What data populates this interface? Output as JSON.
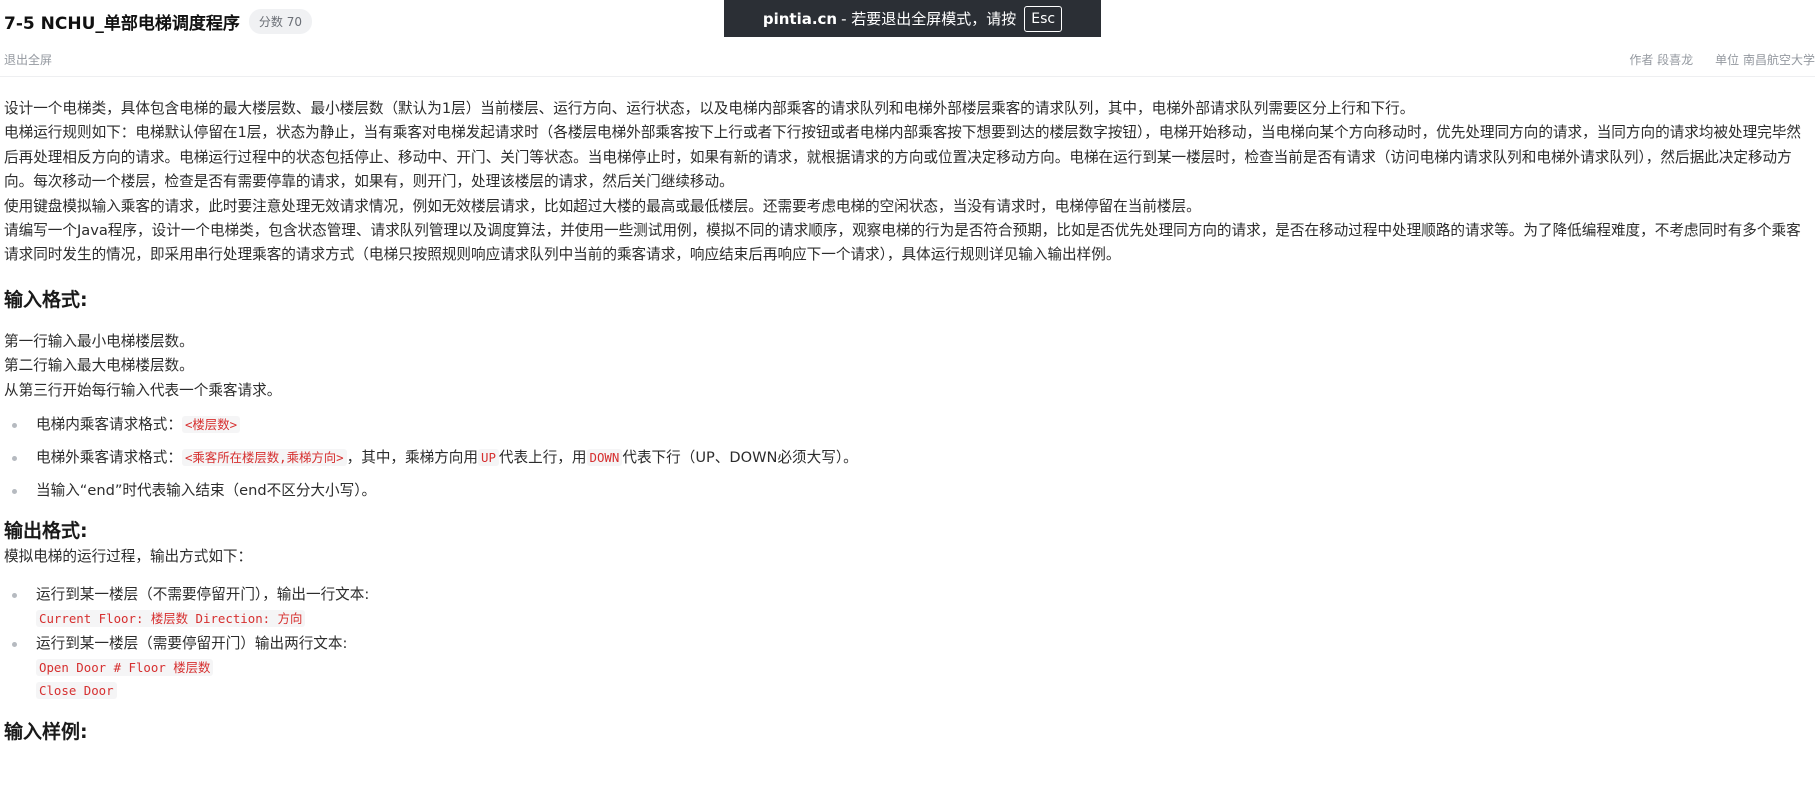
{
  "header": {
    "title": "7-5 NCHU_单部电梯调度程序",
    "score_badge": "分数 70"
  },
  "fullscreen_banner": {
    "domain": "pintia.cn",
    "text": "- 若要退出全屏模式，请按",
    "key": "Esc"
  },
  "toolbar": {
    "exit_fullscreen": "退出全屏",
    "author": "作者 段喜龙",
    "unit": "单位 南昌航空大学"
  },
  "description": {
    "paragraphs": [
      "设计一个电梯类，具体包含电梯的最大楼层数、最小楼层数（默认为1层）当前楼层、运行方向、运行状态，以及电梯内部乘客的请求队列和电梯外部楼层乘客的请求队列，其中，电梯外部请求队列需要区分上行和下行。",
      "电梯运行规则如下：电梯默认停留在1层，状态为静止，当有乘客对电梯发起请求时（各楼层电梯外部乘客按下上行或者下行按钮或者电梯内部乘客按下想要到达的楼层数字按钮），电梯开始移动，当电梯向某个方向移动时，优先处理同方向的请求，当同方向的请求均被处理完毕然后再处理相反方向的请求。电梯运行过程中的状态包括停止、移动中、开门、关门等状态。当电梯停止时，如果有新的请求，就根据请求的方向或位置决定移动方向。电梯在运行到某一楼层时，检查当前是否有请求（访问电梯内请求队列和电梯外请求队列），然后据此决定移动方向。每次移动一个楼层，检查是否有需要停靠的请求，如果有，则开门，处理该楼层的请求，然后关门继续移动。",
      "使用键盘模拟输入乘客的请求，此时要注意处理无效请求情况，例如无效楼层请求，比如超过大楼的最高或最低楼层。还需要考虑电梯的空闲状态，当没有请求时，电梯停留在当前楼层。",
      "请编写一个Java程序，设计一个电梯类，包含状态管理、请求队列管理以及调度算法，并使用一些测试用例，模拟不同的请求顺序，观察电梯的行为是否符合预期，比如是否优先处理同方向的请求，是否在移动过程中处理顺路的请求等。为了降低编程难度，不考虑同时有多个乘客请求同时发生的情况，即采用串行处理乘客的请求方式（电梯只按照规则响应请求队列中当前的乘客请求，响应结束后再响应下一个请求），具体运行规则详见输入输出样例。"
    ]
  },
  "input_format": {
    "heading": "输入格式:",
    "lines": [
      "第一行输入最小电梯楼层数。",
      "第二行输入最大电梯楼层数。",
      "从第三行开始每行输入代表一个乘客请求。"
    ],
    "bullet1": {
      "text": "电梯内乘客请求格式：",
      "code": "<楼层数>"
    },
    "bullet2": {
      "text": "电梯外乘客请求格式：",
      "code": "<乘客所在楼层数,乘梯方向>",
      "mid1": "，其中，乘梯方向用",
      "code_up": "UP",
      "mid2": "代表上行，用",
      "code_down": "DOWN",
      "end": "代表下行（UP、DOWN必须大写）。"
    },
    "bullet3": {
      "text": "当输入“end”时代表输入结束（end不区分大小写）。"
    }
  },
  "output_format": {
    "heading": "输出格式:",
    "intro": "模拟电梯的运行过程，输出方式如下：",
    "bullet1": {
      "text": "运行到某一楼层（不需要停留开门），输出一行文本:",
      "code": "Current Floor: 楼层数 Direction: 方向"
    },
    "bullet2": {
      "text": "运行到某一楼层（需要停留开门）输出两行文本:",
      "code_line1": "Open Door # Floor 楼层数",
      "code_line2": "Close Door"
    }
  },
  "input_sample": {
    "heading": "输入样例:"
  }
}
